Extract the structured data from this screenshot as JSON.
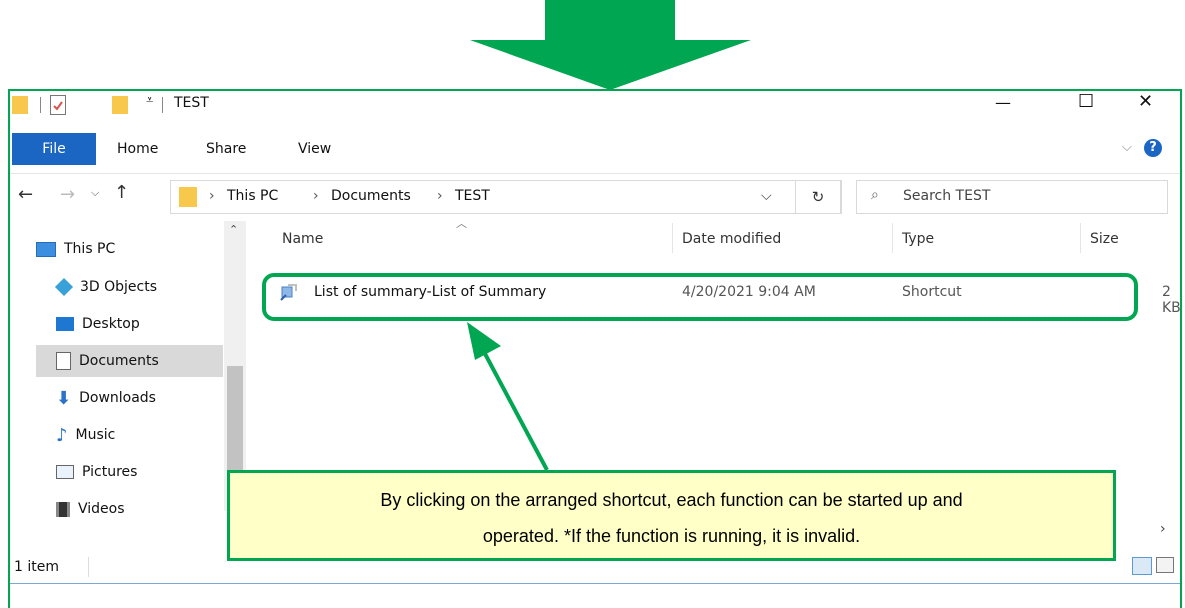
{
  "window": {
    "title": "TEST",
    "controls": {
      "minimize": "—",
      "maximize": "☐",
      "close": "✕"
    }
  },
  "ribbon": {
    "tabs": [
      "File",
      "Home",
      "Share",
      "View"
    ],
    "help": "?"
  },
  "address": {
    "path": [
      "This PC",
      "Documents",
      "TEST"
    ],
    "search_placeholder": "Search TEST"
  },
  "nav_items": [
    {
      "label": "This PC",
      "icon": "monitor-icon"
    },
    {
      "label": "3D Objects",
      "icon": "cube-icon"
    },
    {
      "label": "Desktop",
      "icon": "desktop-icon"
    },
    {
      "label": "Documents",
      "icon": "document-icon",
      "selected": true
    },
    {
      "label": "Downloads",
      "icon": "download-icon"
    },
    {
      "label": "Music",
      "icon": "music-icon"
    },
    {
      "label": "Pictures",
      "icon": "pictures-icon"
    },
    {
      "label": "Videos",
      "icon": "video-icon"
    }
  ],
  "columns": [
    "Name",
    "Date modified",
    "Type",
    "Size"
  ],
  "files": [
    {
      "name": "List of summary-List of Summary",
      "date": "4/20/2021 9:04 AM",
      "type": "Shortcut",
      "size": "2 KB"
    }
  ],
  "status": {
    "count": "1 item"
  },
  "callout": {
    "line1": "By clicking on the arranged shortcut, each function can be started up and",
    "line2": "operated. *If the function is running, it is invalid."
  },
  "colors": {
    "accent": "#00a651",
    "callout_bg": "#ffffc8",
    "file_tab": "#1a66c2"
  }
}
